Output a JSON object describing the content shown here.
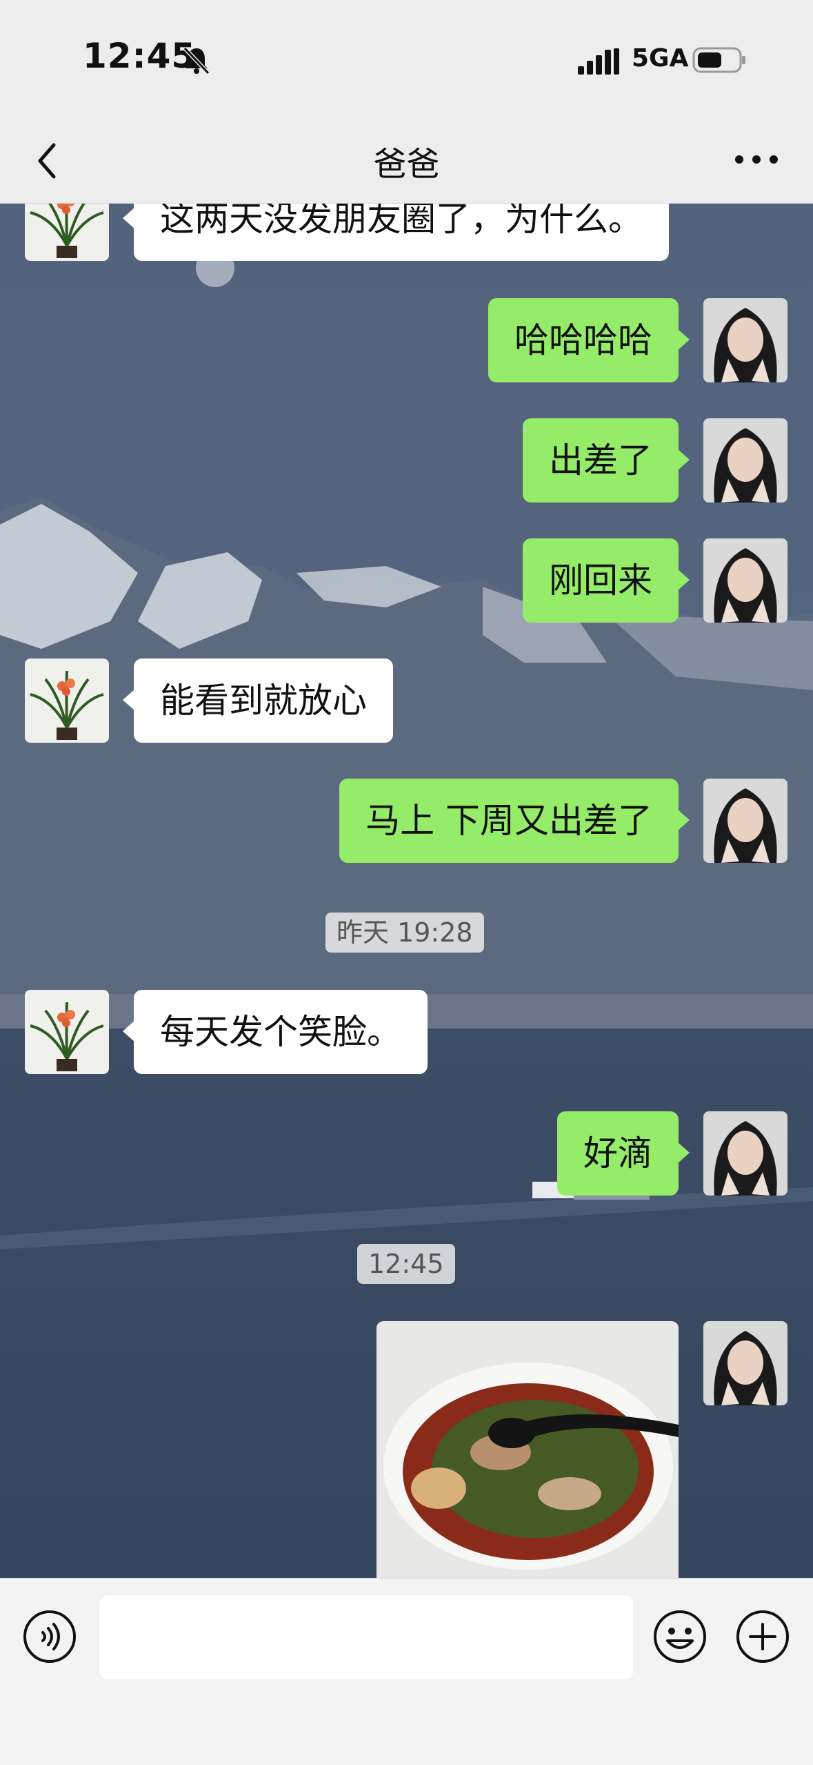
{
  "status_bar": {
    "time": "12:45",
    "network": "5GA",
    "icons": [
      "bell-muted-icon",
      "signal-icon",
      "battery-icon"
    ]
  },
  "nav": {
    "title": "爸爸",
    "icons": [
      "back-chevron-icon",
      "more-icon"
    ]
  },
  "messages": [
    {
      "from": "contact",
      "text": "这两天没发朋友圈了，为什么。"
    },
    {
      "from": "me",
      "text": "哈哈哈哈"
    },
    {
      "from": "me",
      "text": "出差了"
    },
    {
      "from": "me",
      "text": "刚回来"
    },
    {
      "from": "contact",
      "text": "能看到就放心"
    },
    {
      "from": "me",
      "text": "马上 下周又出差了"
    },
    {
      "time": "昨天 19:28"
    },
    {
      "from": "contact",
      "text": "每天发个笑脸。"
    },
    {
      "from": "me",
      "text": "好滴"
    },
    {
      "time": "12:45"
    },
    {
      "from": "me",
      "type": "image",
      "content": "food-photo-noodle-soup"
    }
  ],
  "input_bar": {
    "placeholder": "",
    "icons": [
      "voice-icon",
      "emoji-icon",
      "plus-icon"
    ]
  },
  "colors": {
    "outgoing_bubble": "#95ec69",
    "incoming_bubble": "#ffffff",
    "bar_background": "#ededed"
  }
}
